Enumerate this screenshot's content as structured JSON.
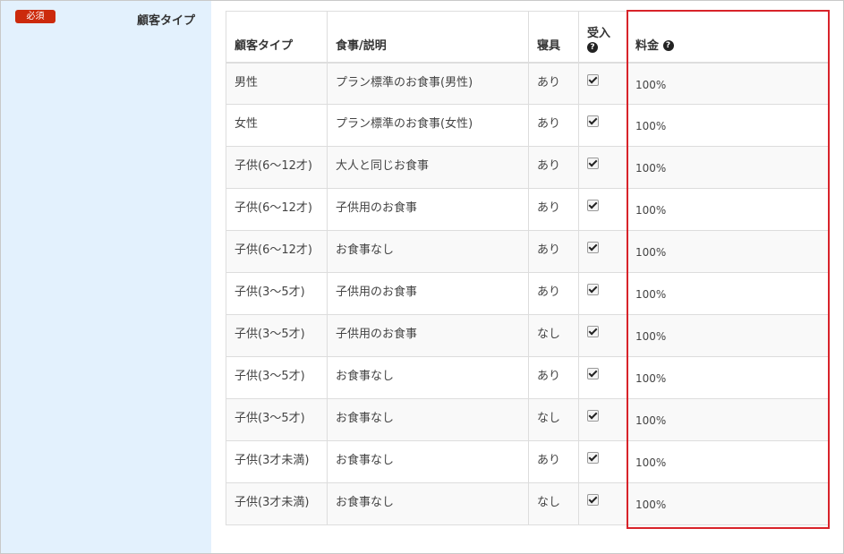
{
  "form": {
    "required_badge": "必須",
    "field_label": "顧客タイプ"
  },
  "table": {
    "headers": {
      "type": "顧客タイプ",
      "meal": "食事/説明",
      "bedding": "寝具",
      "accept": "受入",
      "price": "料金"
    },
    "rows": [
      {
        "type": "男性",
        "meal": "プラン標準のお食事(男性)",
        "bedding": "あり",
        "accepted": true,
        "price": "100%"
      },
      {
        "type": "女性",
        "meal": "プラン標準のお食事(女性)",
        "bedding": "あり",
        "accepted": true,
        "price": "100%"
      },
      {
        "type": "子供(6〜12才)",
        "meal": "大人と同じお食事",
        "bedding": "あり",
        "accepted": true,
        "price": "100%"
      },
      {
        "type": "子供(6〜12才)",
        "meal": "子供用のお食事",
        "bedding": "あり",
        "accepted": true,
        "price": "100%"
      },
      {
        "type": "子供(6〜12才)",
        "meal": "お食事なし",
        "bedding": "あり",
        "accepted": true,
        "price": "100%"
      },
      {
        "type": "子供(3〜5才)",
        "meal": "子供用のお食事",
        "bedding": "あり",
        "accepted": true,
        "price": "100%"
      },
      {
        "type": "子供(3〜5才)",
        "meal": "子供用のお食事",
        "bedding": "なし",
        "accepted": true,
        "price": "100%"
      },
      {
        "type": "子供(3〜5才)",
        "meal": "お食事なし",
        "bedding": "あり",
        "accepted": true,
        "price": "100%"
      },
      {
        "type": "子供(3〜5才)",
        "meal": "お食事なし",
        "bedding": "なし",
        "accepted": true,
        "price": "100%"
      },
      {
        "type": "子供(3才未満)",
        "meal": "お食事なし",
        "bedding": "あり",
        "accepted": true,
        "price": "100%"
      },
      {
        "type": "子供(3才未満)",
        "meal": "お食事なし",
        "bedding": "なし",
        "accepted": true,
        "price": "100%"
      }
    ]
  },
  "icons": {
    "help": "question-circle-icon",
    "check": "checkbox-checked-icon"
  },
  "colors": {
    "sidebar_bg": "#e3f1fd",
    "badge_bg": "#cc2a0c",
    "highlight_border": "#d8232a",
    "row_stripe": "#f9f9f9"
  }
}
